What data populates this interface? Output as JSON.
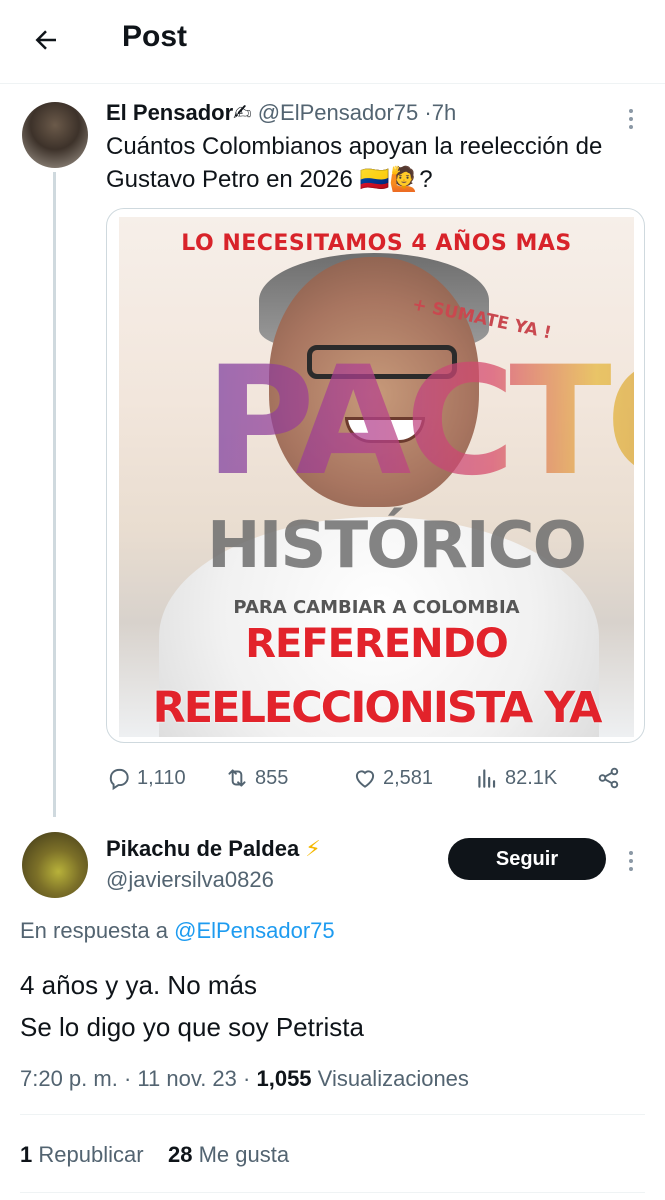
{
  "header": {
    "title": "Post"
  },
  "original_post": {
    "author_name": "El Pensador✍",
    "handle": "@ElPensador75",
    "separator": "·",
    "time": "7h",
    "text": "Cuántos Colombianos apoyan la reelección de Gustavo Petro en 2026 🇨🇴🙋?",
    "image": {
      "top_text": "LO NECESITAMOS 4 AÑOS MAS",
      "sumate_text": "+ SUMATE YA !",
      "pacto_text": "PACTO",
      "historico_text": "HISTÓRICO",
      "para_text": "PARA CAMBIAR A COLOMBIA",
      "referendo_text": "REFERENDO",
      "reeleccionista_text": "REELECCIONISTA YA"
    },
    "actions": {
      "replies": "1,110",
      "reposts": "855",
      "likes": "2,581",
      "views": "82.1K"
    }
  },
  "reply_post": {
    "author_name": "Pikachu de Paldea",
    "badge_emoji": "⚡",
    "handle": "@javiersilva0826",
    "follow_label": "Seguir",
    "reply_prefix": "En respuesta a",
    "reply_mention": "@ElPensador75",
    "text_line1": "4 años y ya. No más",
    "text_line2": "Se lo digo yo que soy Petrista",
    "time": "7:20 p. m.",
    "dot": "·",
    "date": "11 nov. 23",
    "views_count": "1,055",
    "views_label": "Visualizaciones",
    "reposts_count": "1",
    "reposts_label": "Republicar",
    "likes_count": "28",
    "likes_label": "Me gusta"
  },
  "colors": {
    "text_primary": "#0f1419",
    "text_secondary": "#536471",
    "link": "#1d9bf0",
    "button_dark": "#0f1419",
    "divider": "#eff3f4",
    "thread_line": "#cfd9de",
    "poster_red": "#e2232b"
  },
  "icons": [
    "back-arrow-icon",
    "more-icon",
    "reply-icon",
    "repost-icon",
    "like-icon",
    "views-icon",
    "share-icon",
    "lightning-icon"
  ]
}
